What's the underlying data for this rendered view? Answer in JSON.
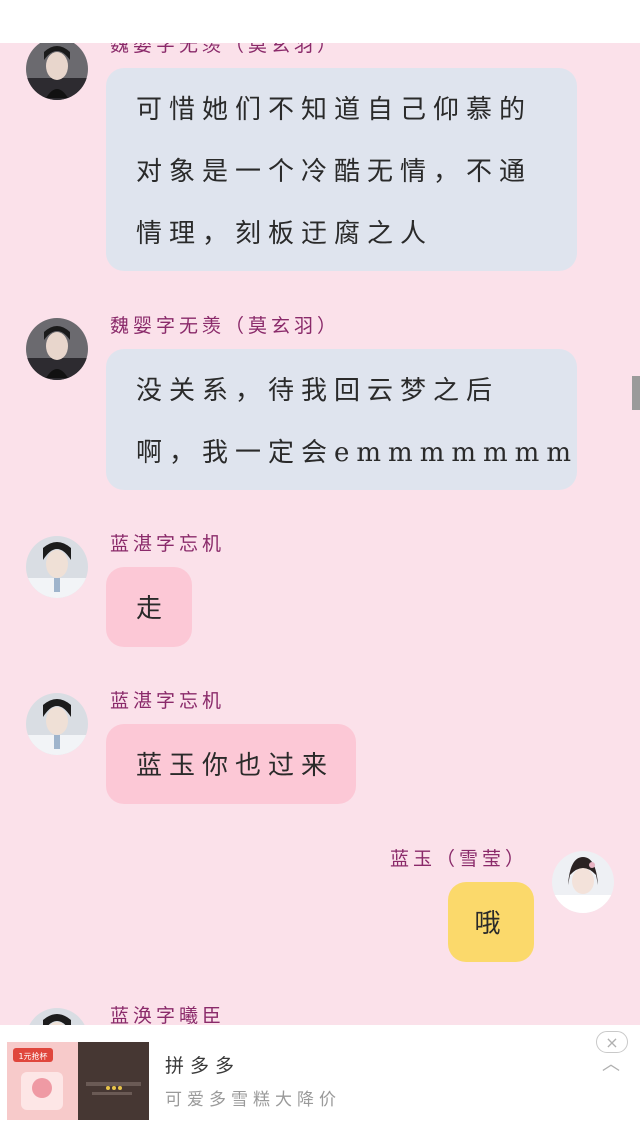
{
  "messages": [
    {
      "sender": "魏婴字无羡（莫玄羽）",
      "lines": [
        "可惜她们不知道自己仰慕的",
        "对象是一个冷酷无情，不通",
        "情理，刻板迂腐之人"
      ]
    },
    {
      "sender": "魏婴字无羡（莫玄羽）",
      "lines": [
        "没关系，待我回云梦之后",
        "啊，我一定会emmmmmmm"
      ]
    },
    {
      "sender": "蓝湛字忘机",
      "lines": [
        "走"
      ]
    },
    {
      "sender": "蓝湛字忘机",
      "lines": [
        "蓝玉你也过来"
      ]
    },
    {
      "sender": "蓝玉（雪莹）",
      "lines": [
        "哦"
      ]
    },
    {
      "sender": "蓝涣字曦臣",
      "lines": []
    }
  ],
  "ad": {
    "title": "拼多多",
    "subtitle": "可爱多雪糕大降价",
    "badge": "1元抢杯",
    "close_icon": "×",
    "collapse_icon": "︿"
  },
  "icons": {
    "avatar_wei": "avatar-wei-icon",
    "avatar_lan": "avatar-lan-icon",
    "avatar_self": "avatar-self-icon"
  }
}
